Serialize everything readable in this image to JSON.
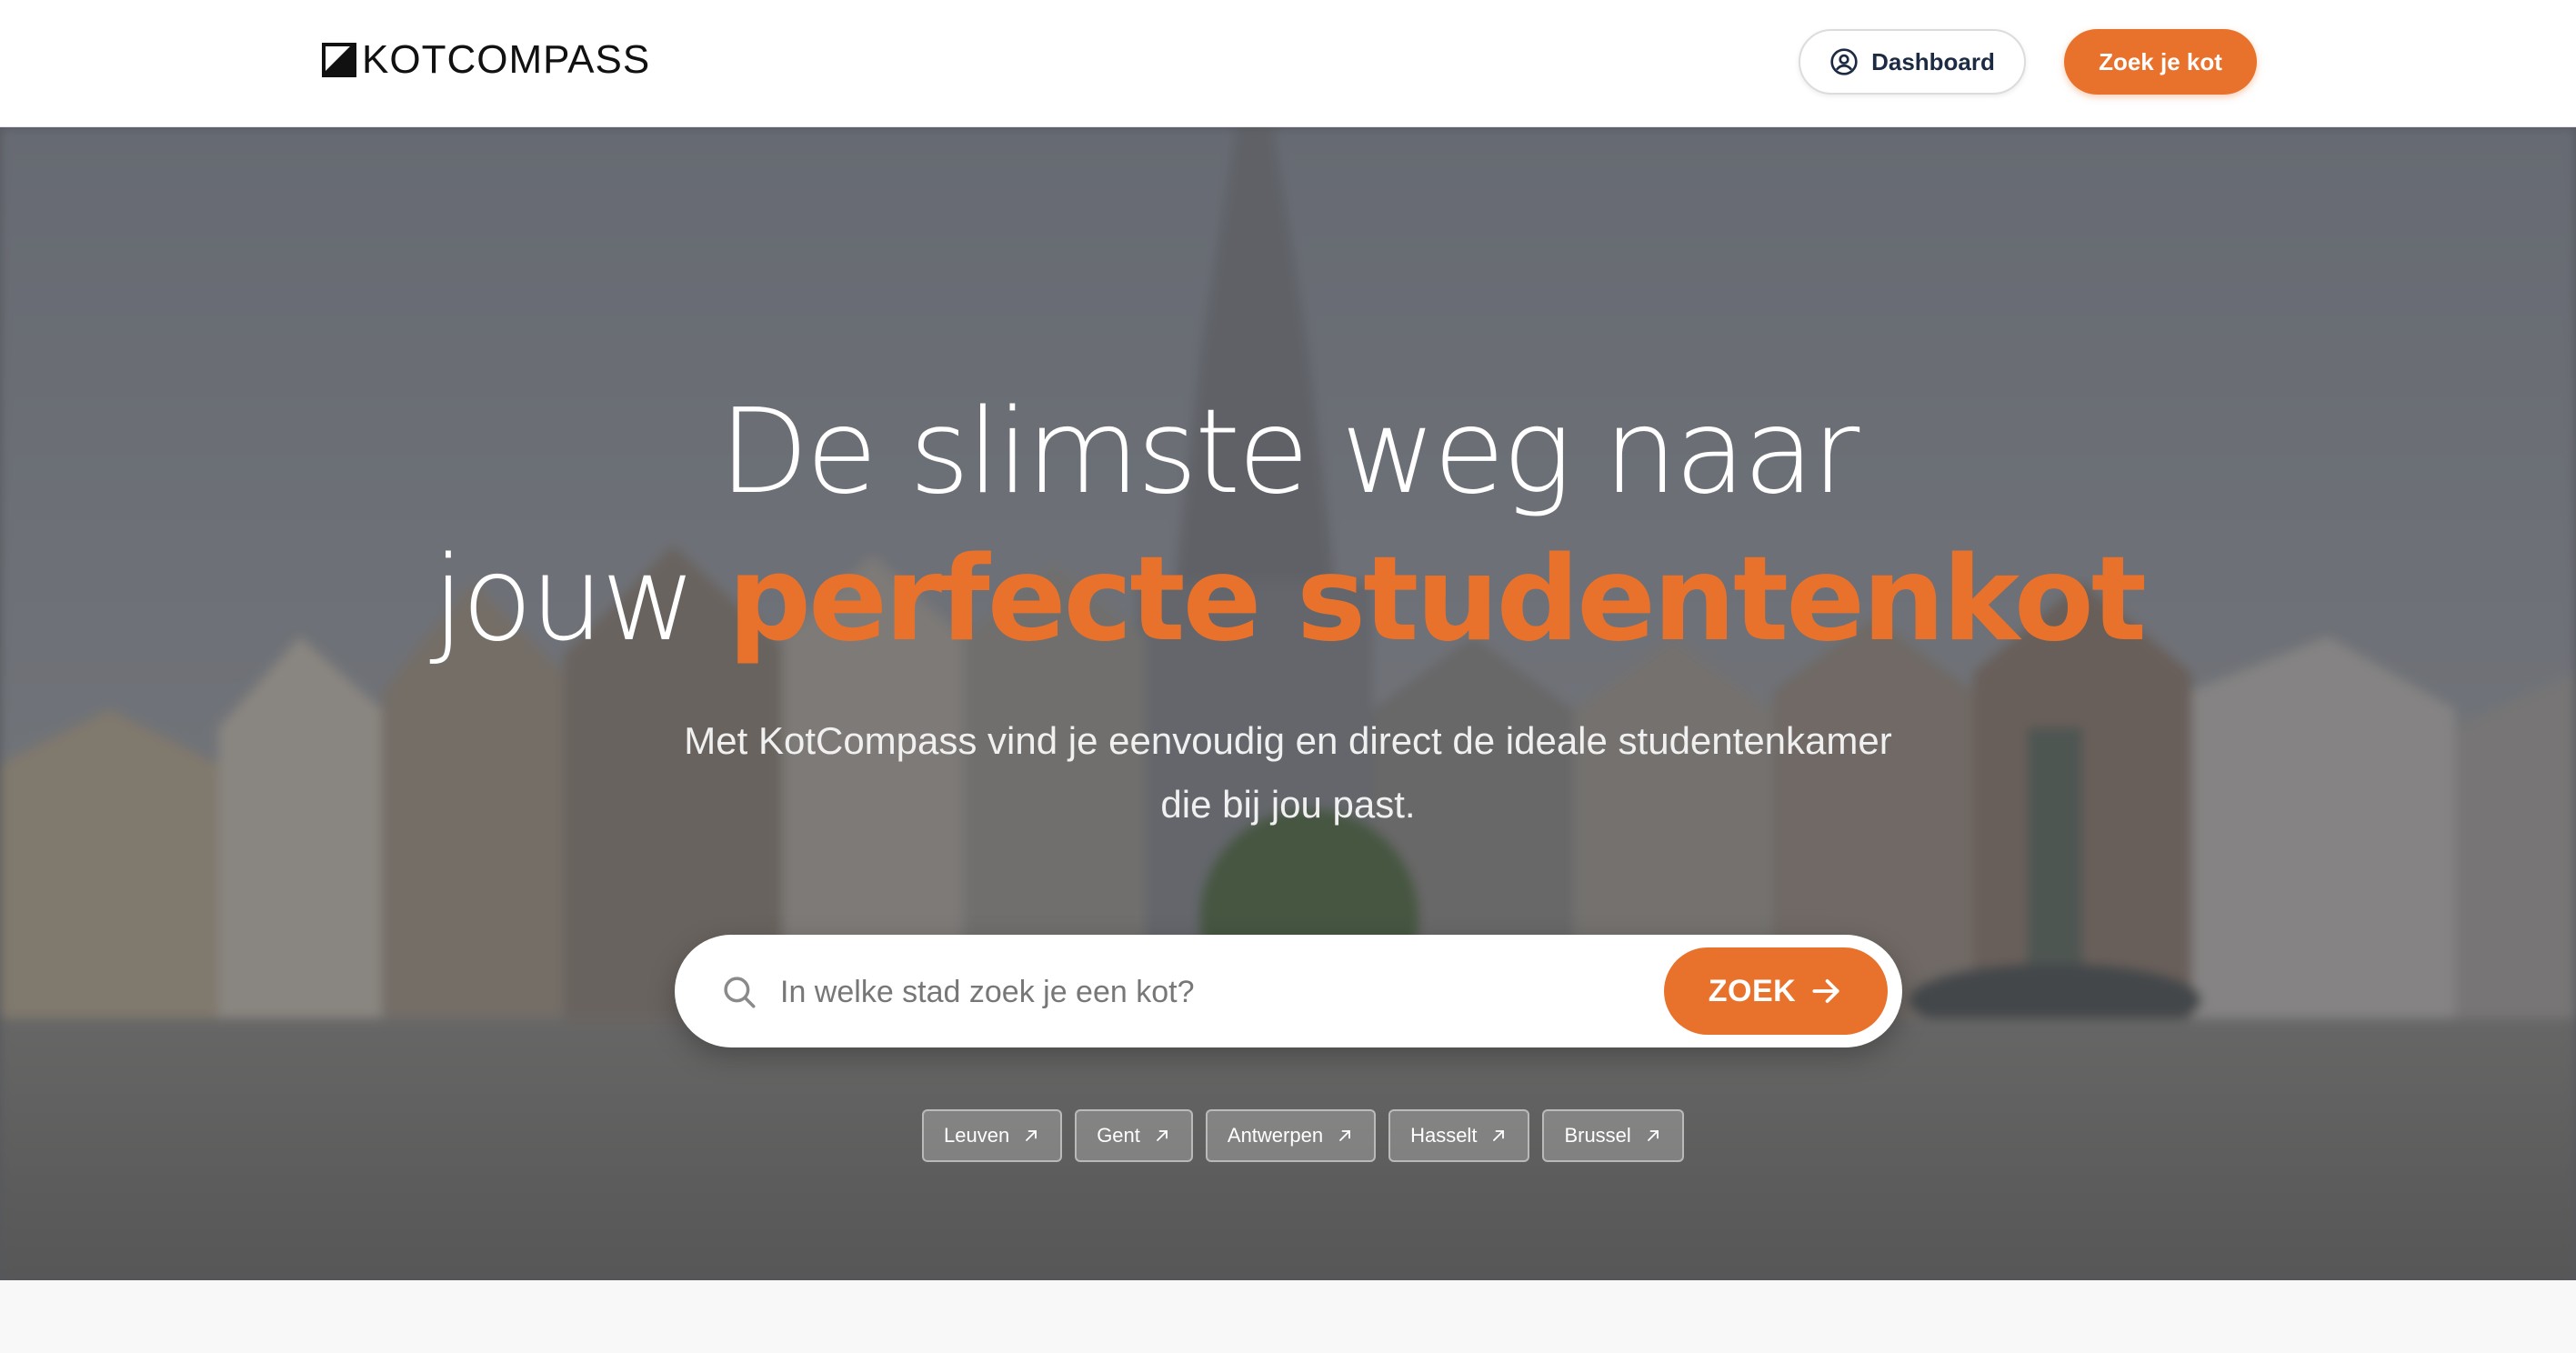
{
  "header": {
    "logo_text": "KOTCOMPASS",
    "dashboard_label": "Dashboard",
    "cta_label": "Zoek je kot"
  },
  "hero": {
    "headline_line1": "De slimste weg naar",
    "headline_line2_prefix": "jouw",
    "headline_line2_accent": "perfecte studentenkot",
    "subtitle_line1": "Met KotCompass vind je eenvoudig en direct de ideale studentenkamer",
    "subtitle_line2": "die bij jou past.",
    "search": {
      "placeholder": "In welke stad zoek je een kot?",
      "button_label": "ZOEK"
    },
    "cities": [
      {
        "label": "Leuven"
      },
      {
        "label": "Gent"
      },
      {
        "label": "Antwerpen"
      },
      {
        "label": "Hasselt"
      },
      {
        "label": "Brussel"
      }
    ]
  },
  "colors": {
    "accent": "#e8722c",
    "text_dark": "#1d2a44",
    "white": "#ffffff"
  },
  "icons": {
    "dashboard": "user-circle-icon",
    "search": "search-icon",
    "search_button": "arrow-right-icon",
    "chip": "arrow-up-right-icon"
  }
}
